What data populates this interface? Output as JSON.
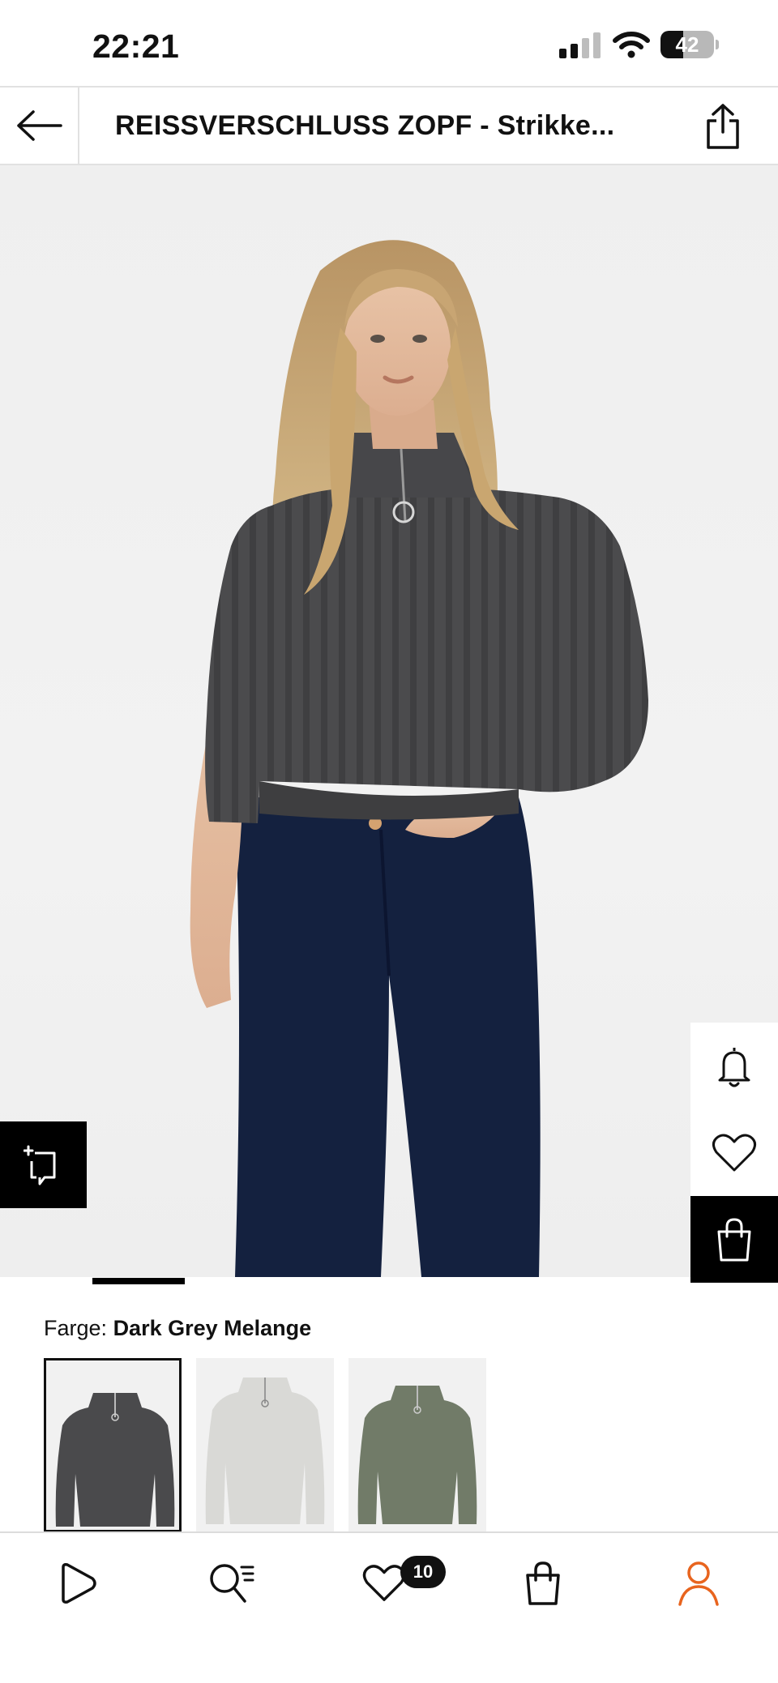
{
  "status_bar": {
    "time": "22:21",
    "battery_level": "42",
    "battery_fraction": 0.42,
    "signal_bars_active": 2,
    "signal_bars_total": 4
  },
  "header": {
    "title": "REISSVERSCHLUSS ZOPF - Strikke...",
    "back_icon": "arrow-left-icon",
    "share_icon": "share-icon"
  },
  "product_image": {
    "carousel_active_index": 1,
    "compare_icon": "compare-icon",
    "actions": [
      {
        "name": "notify",
        "icon": "bell-icon"
      },
      {
        "name": "wishlist",
        "icon": "heart-icon"
      },
      {
        "name": "add-to-bag",
        "icon": "shopping-bag-icon"
      }
    ]
  },
  "color": {
    "label": "Farge:",
    "selected_value": "Dark Grey Melange",
    "swatches": [
      {
        "color": "#4a4a4c",
        "selected": true
      },
      {
        "color": "#d9d9d6",
        "selected": false
      },
      {
        "color": "#717b68",
        "selected": false
      }
    ]
  },
  "bottom_nav": {
    "items": [
      {
        "name": "inspiration",
        "icon": "play-icon"
      },
      {
        "name": "search",
        "icon": "search-icon"
      },
      {
        "name": "wishlist",
        "icon": "heart-icon",
        "badge": "10"
      },
      {
        "name": "bag",
        "icon": "shopping-bag-icon"
      },
      {
        "name": "account",
        "icon": "user-icon",
        "active": true
      }
    ],
    "accent_color": "#e8641e"
  }
}
